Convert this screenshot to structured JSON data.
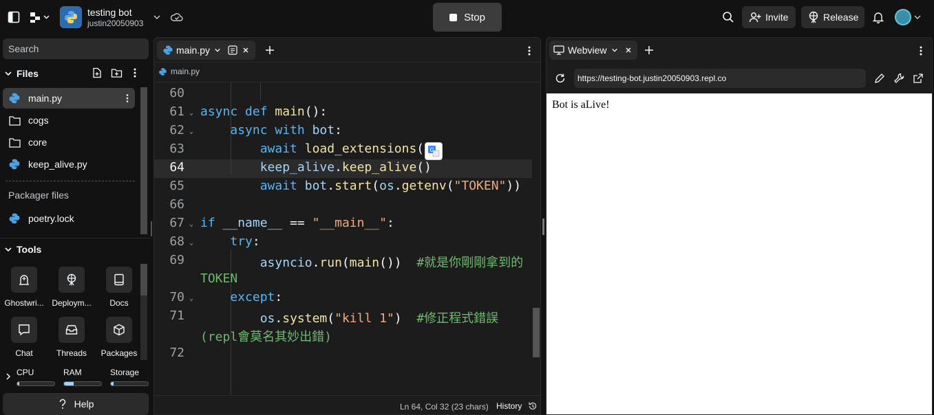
{
  "topbar": {
    "repl_name": "testing bot",
    "repl_owner": "justin20050903",
    "stop_label": "Stop",
    "invite_label": "Invite",
    "release_label": "Release"
  },
  "sidebar": {
    "search_placeholder": "Search",
    "files_header": "Files",
    "files": [
      {
        "name": "main.py",
        "icon": "python-icon",
        "active": true
      },
      {
        "name": "cogs",
        "icon": "folder-icon"
      },
      {
        "name": "core",
        "icon": "folder-icon"
      },
      {
        "name": "keep_alive.py",
        "icon": "python-icon"
      }
    ],
    "packager_header": "Packager files",
    "packager_files": [
      {
        "name": "poetry.lock",
        "icon": "python-icon"
      }
    ],
    "tools_header": "Tools",
    "tools": [
      {
        "label": "Ghostwri...",
        "icon": "ghostwriter-icon"
      },
      {
        "label": "Deploym...",
        "icon": "deployments-icon"
      },
      {
        "label": "Docs",
        "icon": "docs-icon"
      },
      {
        "label": "Chat",
        "icon": "chat-icon"
      },
      {
        "label": "Threads",
        "icon": "threads-icon"
      },
      {
        "label": "Packages",
        "icon": "packages-icon"
      }
    ],
    "resources": {
      "cpu_label": "CPU",
      "cpu_level": 0.05,
      "ram_label": "RAM",
      "ram_level": 0.25,
      "storage_label": "Storage",
      "storage_level": 0.08
    },
    "help_label": "Help"
  },
  "editor": {
    "tab_label": "main.py",
    "breadcrumb": "main.py",
    "lines": [
      {
        "num": "60"
      },
      {
        "num": "61"
      },
      {
        "num": "62"
      },
      {
        "num": "63"
      },
      {
        "num": "64"
      },
      {
        "num": "65"
      },
      {
        "num": "66"
      },
      {
        "num": "67"
      },
      {
        "num": "68"
      },
      {
        "num": "69"
      },
      {
        "num": "70"
      },
      {
        "num": "71"
      },
      {
        "num": "72"
      }
    ],
    "code": {
      "l61_kw1": "async",
      "l61_kw2": "def",
      "l61_fn": "main",
      "l61_rest": "():",
      "l62_kw1": "async",
      "l62_kw2": "with",
      "l62_var": "bot",
      "l62_rest": ":",
      "l63_kw": "await",
      "l63_fn": "load_extensions",
      "l63_rest": "(",
      "l64_var1": "keep_alive",
      "l64_dot": ".",
      "l64_fn": "keep_alive",
      "l64_rest": "()",
      "l65_kw": "await",
      "l65_var1": "bot",
      "l65_dot1": ".",
      "l65_fn1": "start",
      "l65_p1": "(",
      "l65_var2": "os",
      "l65_dot2": ".",
      "l65_fn2": "getenv",
      "l65_p2": "(",
      "l65_str": "\"TOKEN\"",
      "l65_p3": "))",
      "l67_kw": "if",
      "l67_var": "__name__",
      "l67_op": "==",
      "l67_str": "\"__main__\"",
      "l67_rest": ":",
      "l68_kw": "try",
      "l68_rest": ":",
      "l69_var": "asyncio",
      "l69_dot": ".",
      "l69_fn1": "run",
      "l69_p1": "(",
      "l69_fn2": "main",
      "l69_p2": "())",
      "l69_cmt": "#就是你剛剛拿到的",
      "l69_wrap": "TOKEN",
      "l70_kw": "except",
      "l70_rest": ":",
      "l71_var": "os",
      "l71_dot": ".",
      "l71_fn": "system",
      "l71_p1": "(",
      "l71_str": "\"kill 1\"",
      "l71_p2": ")",
      "l71_cmt": "#修正程式錯誤",
      "l71_wrap": "(repl會莫名其妙出錯)"
    },
    "status_position": "Ln 64, Col 32 (23 chars)",
    "history_label": "History"
  },
  "webview": {
    "tab_label": "Webview",
    "url": "https://testing-bot.justin20050903.repl.co",
    "content_text": "Bot is aLive!"
  },
  "colors": {
    "background": "#121212",
    "panel": "#1c1c1c",
    "keyword": "#56b6f5",
    "function": "#f2e3a6",
    "string": "#f5a979",
    "comment": "#6fb86f"
  }
}
